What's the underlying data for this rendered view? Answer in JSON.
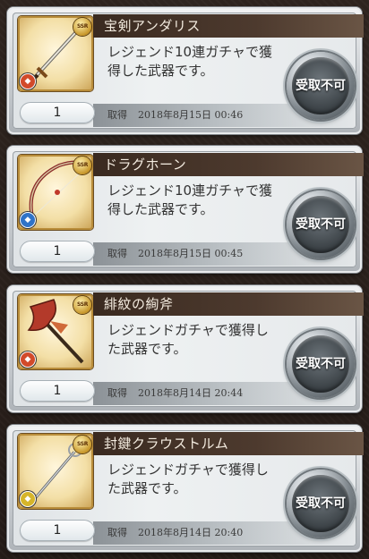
{
  "items": [
    {
      "name": "宝剣アンダリス",
      "rarity": "SSR",
      "element_color": "#d24a2a",
      "element_icon": "fire-element-icon",
      "weapon_icon": "sword-icon",
      "description_line1": "レジェンド10連ガチャで獲",
      "description_line2": "得した武器です。",
      "count": "1",
      "obtained_label": "取得",
      "obtained_date": "2018年8月15日 00:46",
      "receive_label": "受取不可"
    },
    {
      "name": "ドラグホーン",
      "rarity": "SSR",
      "element_color": "#2f73c8",
      "element_icon": "water-element-icon",
      "weapon_icon": "bow-icon",
      "description_line1": "レジェンド10連ガチャで獲",
      "description_line2": "得した武器です。",
      "count": "1",
      "obtained_label": "取得",
      "obtained_date": "2018年8月15日 00:45",
      "receive_label": "受取不可"
    },
    {
      "name": "緋紋の絢斧",
      "rarity": "SSR",
      "element_color": "#d24a2a",
      "element_icon": "fire-element-icon",
      "weapon_icon": "axe-icon",
      "description_line1": "レジェンドガチャで獲得し",
      "description_line2": "た武器です。",
      "count": "1",
      "obtained_label": "取得",
      "obtained_date": "2018年8月14日 20:44",
      "receive_label": "受取不可"
    },
    {
      "name": "封鍵クラウストルム",
      "rarity": "SSR",
      "element_color": "#d6b52a",
      "element_icon": "light-element-icon",
      "weapon_icon": "staff-icon",
      "description_line1": "レジェンドガチャで獲得し",
      "description_line2": "た武器です。",
      "count": "1",
      "obtained_label": "取得",
      "obtained_date": "2018年8月14日 20:40",
      "receive_label": "受取不可"
    }
  ]
}
